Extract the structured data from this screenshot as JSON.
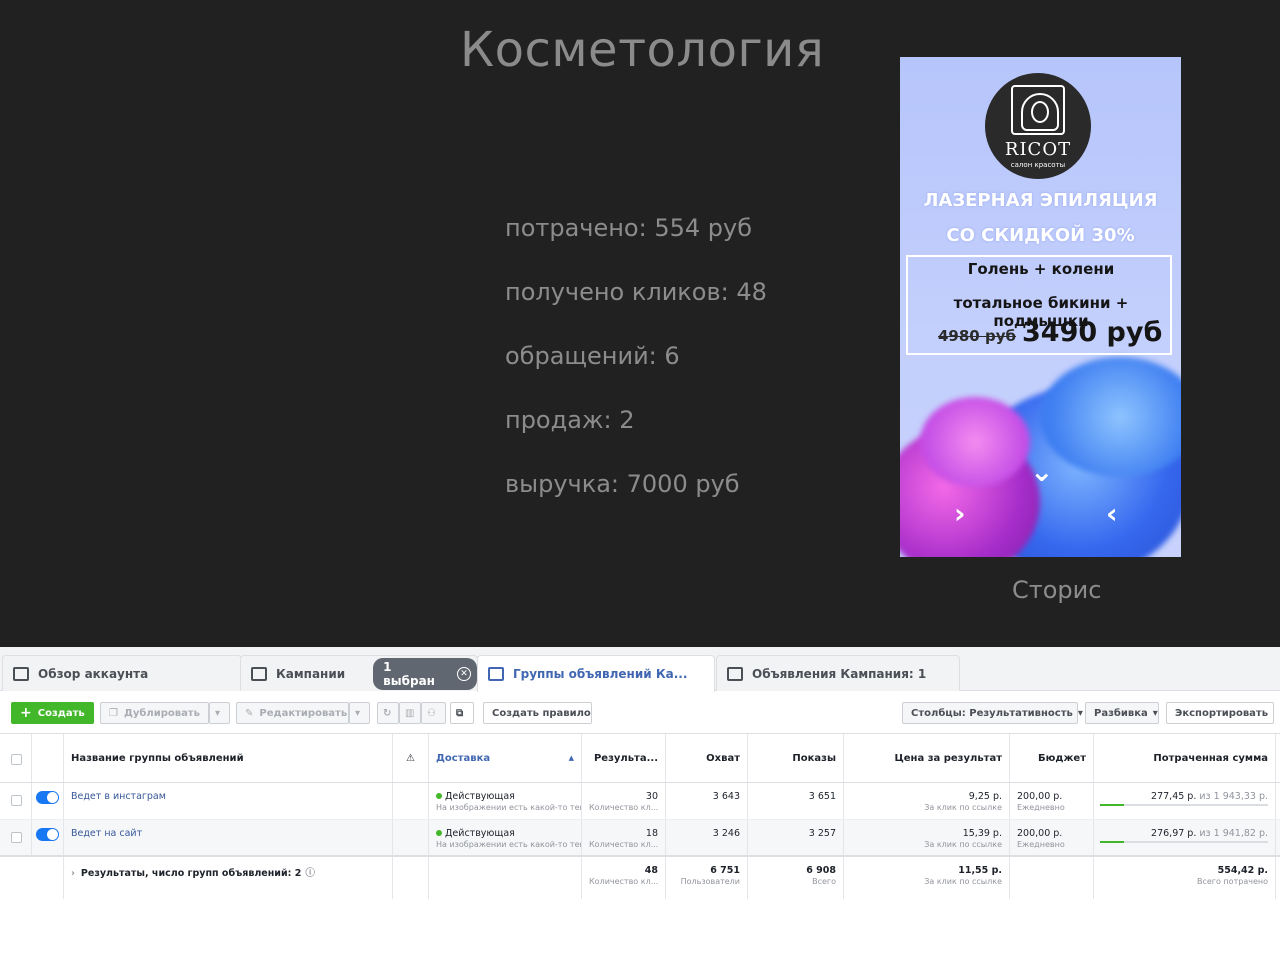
{
  "slide": {
    "title": "Косметология",
    "stats": [
      "потрачено: 554 руб",
      "получено кликов: 48",
      "обращений: 6",
      "продаж: 2",
      "выручка: 7000 руб"
    ],
    "story": {
      "logo_name": "RICOT",
      "logo_sub": "салон красоты",
      "promo_line1": "ЛАЗЕРНАЯ ЭПИЛЯЦИЯ",
      "promo_line2": "СО СКИДКОЙ 30%",
      "offer_line1": "Голень + колени",
      "offer_line2": "тотальное бикини + подмышки",
      "old_price": "4980 руб",
      "new_price": "3490 руб",
      "caption": "Сторис"
    }
  },
  "ads_manager": {
    "tabs": [
      {
        "label": "Обзор аккаунта",
        "icon": "overview-icon"
      },
      {
        "label": "Кампании",
        "icon": "folder-icon",
        "badge": "1 выбран"
      },
      {
        "label": "Группы объявлений Ка...",
        "icon": "grid-icon",
        "active": true
      },
      {
        "label": "Объявления Кампания: 1",
        "icon": "ad-icon"
      }
    ],
    "toolbar": {
      "create": "Создать",
      "duplicate": "Дублировать",
      "edit": "Редактировать",
      "create_rule": "Создать правило",
      "columns": "Столбцы: Результативность",
      "breakdown": "Разбивка",
      "export": "Экспортировать"
    },
    "columns": {
      "name": "Название группы объявлений",
      "delivery": "Доставка",
      "results": "Результа...",
      "reach": "Охват",
      "impressions": "Показы",
      "cost_per_result": "Цена за результат",
      "budget": "Бюджет",
      "spent": "Потраченная сумма"
    },
    "rows": [
      {
        "name": "Ведет в инстаграм",
        "delivery": "Действующая",
        "delivery_note": "На изображении есть какой-то текст",
        "results": "30",
        "results_sub": "Количество кл...",
        "reach": "3 643",
        "impressions": "3 651",
        "cost": "9,25 р.",
        "cost_sub": "За клик по ссылке",
        "budget": "200,00 р.",
        "budget_sub": "Ежедневно",
        "spent_main": "277,45 р.",
        "spent_rest": " из 1 943,33 р.",
        "progress": 0.143
      },
      {
        "name": "Ведет на сайт",
        "delivery": "Действующая",
        "delivery_note": "На изображении есть какой-то текст",
        "results": "18",
        "results_sub": "Количество кл...",
        "reach": "3 246",
        "impressions": "3 257",
        "cost": "15,39 р.",
        "cost_sub": "За клик по ссылке",
        "budget": "200,00 р.",
        "budget_sub": "Ежедневно",
        "spent_main": "276,97 р.",
        "spent_rest": " из 1 941,82 р.",
        "progress": 0.143
      }
    ],
    "totals": {
      "label": "Результаты, число групп объявлений: 2",
      "results": "48",
      "results_sub": "Количество кл...",
      "reach": "6 751",
      "reach_sub": "Пользователи",
      "impressions": "6 908",
      "impressions_sub": "Всего",
      "cost": "11,55 р.",
      "cost_sub": "За клик по ссылке",
      "spent": "554,42 р.",
      "spent_sub": "Всего потрачено"
    },
    "colors": {
      "accent": "#4267b2",
      "create": "#42b72a",
      "toggle": "#1877f2"
    }
  }
}
